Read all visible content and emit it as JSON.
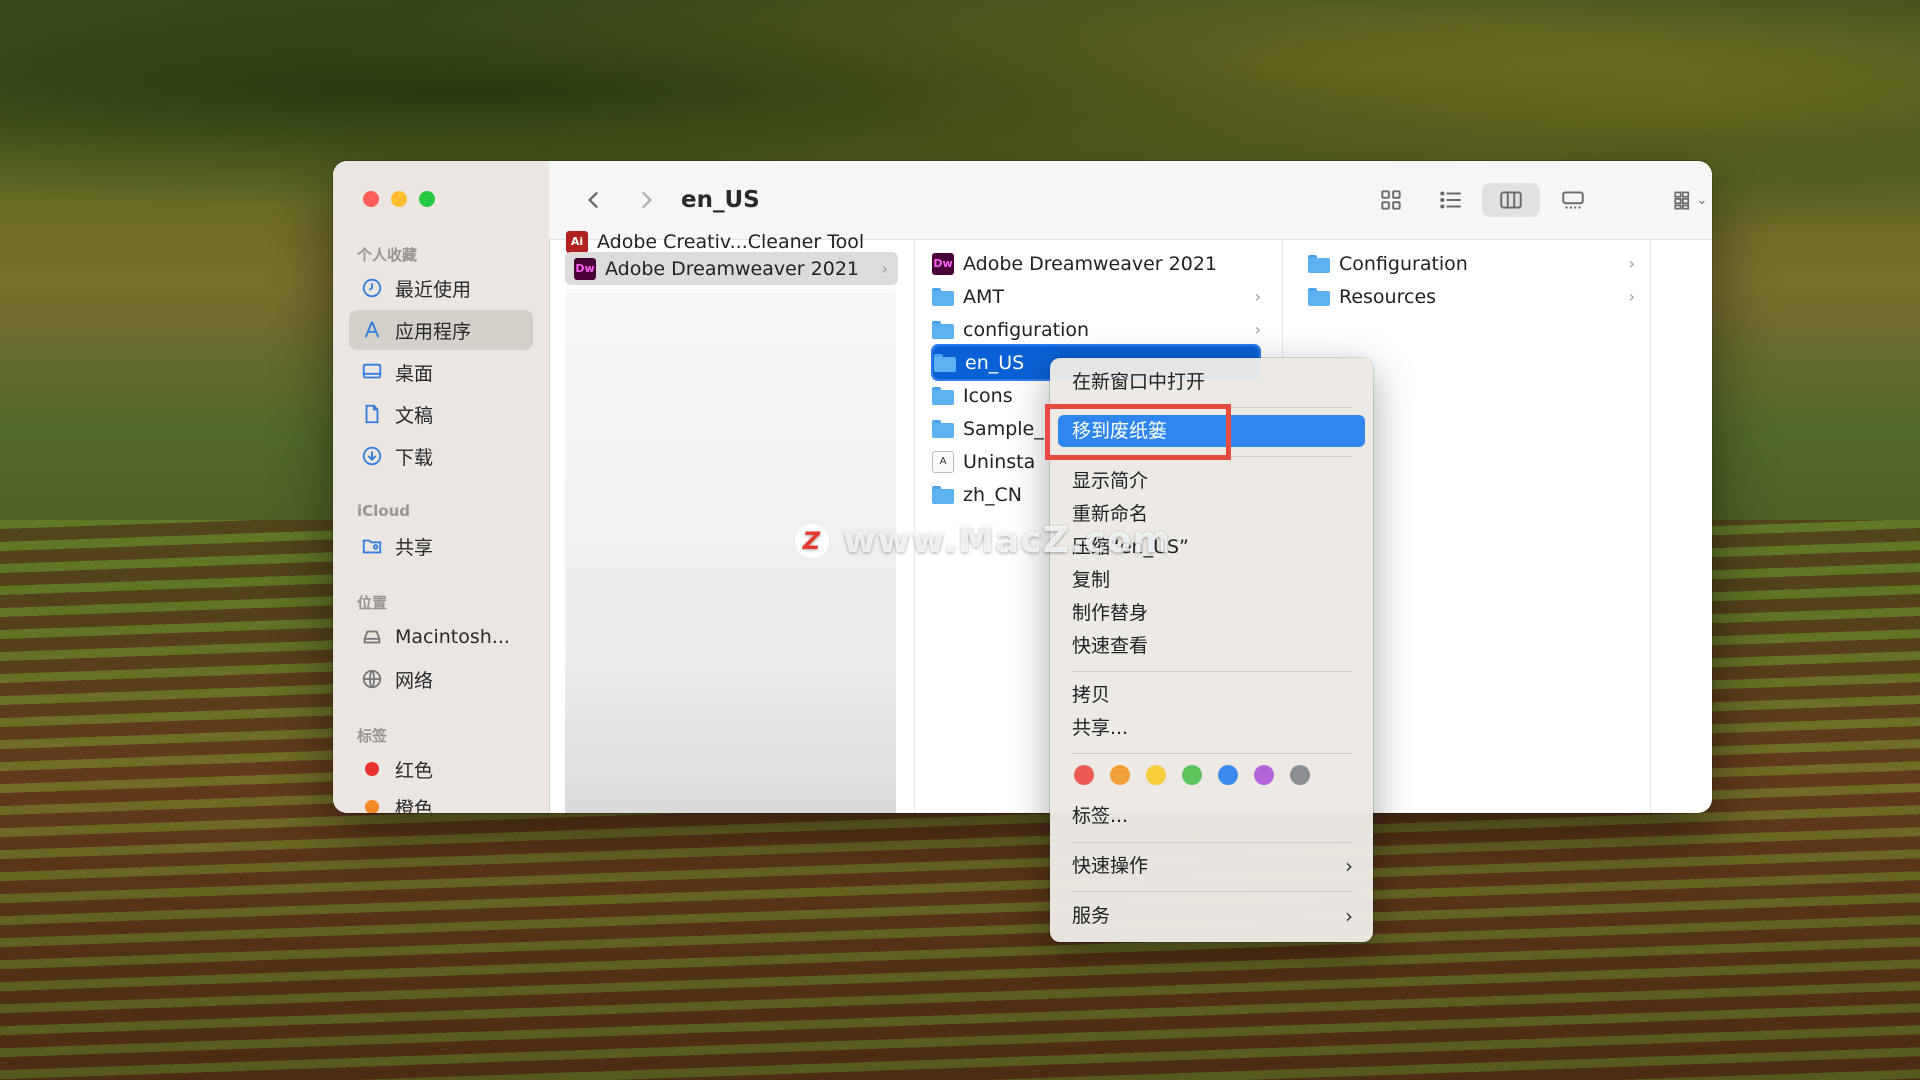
{
  "window": {
    "title": "en_US"
  },
  "sidebar": {
    "favorites_header": "个人收藏",
    "favorites": [
      {
        "label": "最近使用",
        "icon": "clock-icon"
      },
      {
        "label": "应用程序",
        "icon": "apps-icon",
        "selected": true
      },
      {
        "label": "桌面",
        "icon": "desktop-icon"
      },
      {
        "label": "文稿",
        "icon": "document-icon"
      },
      {
        "label": "下载",
        "icon": "download-icon"
      }
    ],
    "icloud_header": "iCloud",
    "icloud": [
      {
        "label": "共享",
        "icon": "shared-folder-icon"
      }
    ],
    "locations_header": "位置",
    "locations": [
      {
        "label": "Macintosh...",
        "icon": "disk-icon"
      },
      {
        "label": "网络",
        "icon": "network-icon"
      }
    ],
    "tags_header": "标签",
    "tags": [
      {
        "label": "红色",
        "color": "#e8322b"
      },
      {
        "label": "橙色",
        "color": "#f08a24"
      }
    ]
  },
  "columns": {
    "col1": [
      {
        "label": "Adobe Creativ...Cleaner Tool"
      },
      {
        "label": "Adobe Dreamweaver 2021",
        "selected": true
      }
    ],
    "col2": [
      {
        "label": "Adobe Dreamweaver 2021",
        "type": "app"
      },
      {
        "label": "AMT",
        "type": "folder"
      },
      {
        "label": "configuration",
        "type": "folder"
      },
      {
        "label": "en_US",
        "type": "folder",
        "selected": true
      },
      {
        "label": "Icons",
        "type": "folder"
      },
      {
        "label": "Sample_",
        "type": "folder"
      },
      {
        "label": "Uninsta",
        "type": "app"
      },
      {
        "label": "zh_CN",
        "type": "folder"
      }
    ],
    "col3": [
      {
        "label": "Configuration",
        "type": "folder"
      },
      {
        "label": "Resources",
        "type": "folder"
      }
    ]
  },
  "context_menu": {
    "items": [
      "在新窗口中打开",
      "移到废纸篓",
      "显示简介",
      "重新命名",
      "压缩“en_US”",
      "复制",
      "制作替身",
      "快速查看",
      "拷贝",
      "共享...",
      "标签...",
      "快速操作",
      "服务"
    ],
    "highlighted": "移到废纸篓",
    "tag_colors": [
      "#ed5a54",
      "#f3a03a",
      "#f5cd3d",
      "#5cc45a",
      "#3b8bee",
      "#b464d8",
      "#8e8e92"
    ]
  },
  "watermark": {
    "badge": "Z",
    "text": "www.MacZ.com"
  },
  "colors": {
    "selection_blue": "#0a61d6",
    "menu_highlight": "#2f86ef",
    "annotation_red": "#e84a3f"
  }
}
